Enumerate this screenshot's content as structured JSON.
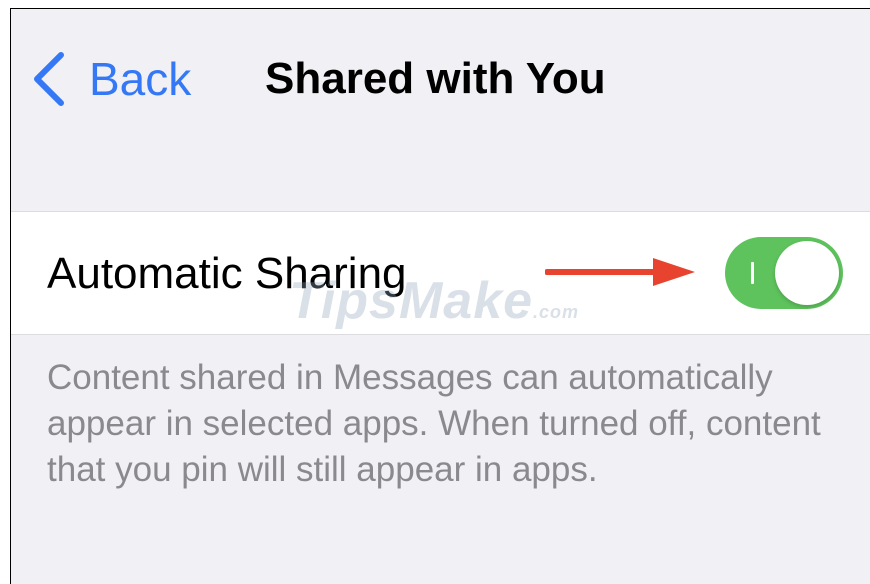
{
  "nav": {
    "back_label": "Back",
    "title": "Shared with You"
  },
  "settings": {
    "automatic_sharing": {
      "label": "Automatic Sharing",
      "enabled": true,
      "on_color": "#5ec35d"
    },
    "footer_text": "Content shared in Messages can automatically appear in selected apps. When turned off, content that you pin will still appear in apps."
  },
  "annotation": {
    "arrow_color": "#e8432f",
    "icon": "arrow-right-icon"
  },
  "watermark": {
    "text": "TipsMake",
    "suffix": ".com"
  },
  "colors": {
    "accent": "#3478f6",
    "background": "#f1f0f5"
  }
}
